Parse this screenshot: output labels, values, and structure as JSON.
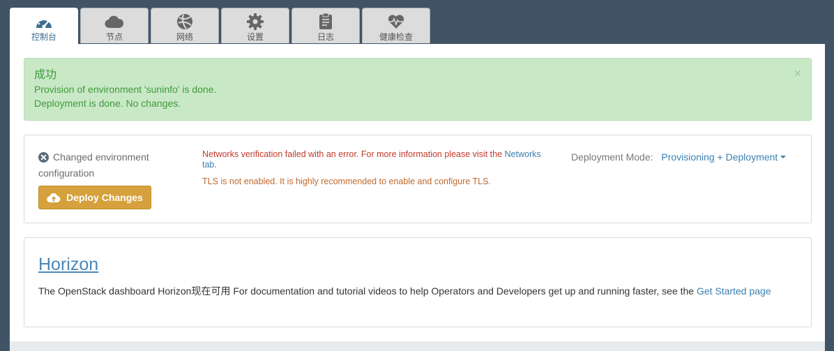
{
  "tabs": [
    {
      "label": "控制台",
      "icon": "dashboard-icon",
      "active": true
    },
    {
      "label": "节点",
      "icon": "cloud-icon",
      "active": false
    },
    {
      "label": "网络",
      "icon": "network-icon",
      "active": false
    },
    {
      "label": "设置",
      "icon": "gear-icon",
      "active": false
    },
    {
      "label": "日志",
      "icon": "clipboard-icon",
      "active": false
    },
    {
      "label": "健康检查",
      "icon": "heartbeat-icon",
      "active": false
    }
  ],
  "alert": {
    "title": "成功",
    "lines": [
      "Provision of environment 'suninfo' is done.",
      "Deployment is done. No changes."
    ],
    "close": "×"
  },
  "deploy": {
    "changed_label": "Changed environment configuration",
    "button_label": "Deploy Changes",
    "error_text": "Networks verification failed with an error. For more information please visit the",
    "error_link": "Networks tab",
    "error_suffix": ".",
    "warning_text": "TLS is not enabled. It is highly recommended to enable and configure TLS.",
    "mode_label": "Deployment Mode:",
    "mode_value": "Provisioning + Deployment"
  },
  "horizon": {
    "title": "Horizon",
    "text": "The OpenStack dashboard Horizon现在可用 For documentation and tutorial videos to help Operators and Developers get up and running faster, see the ",
    "link": "Get Started page"
  },
  "colors": {
    "background": "#415466",
    "success_bg": "#c9e8c6",
    "success_text": "#3f9a3c",
    "deploy_button": "#d6a13c",
    "error_text": "#c0392b",
    "warning_text": "#c0692b",
    "link": "#3c7fb0"
  }
}
